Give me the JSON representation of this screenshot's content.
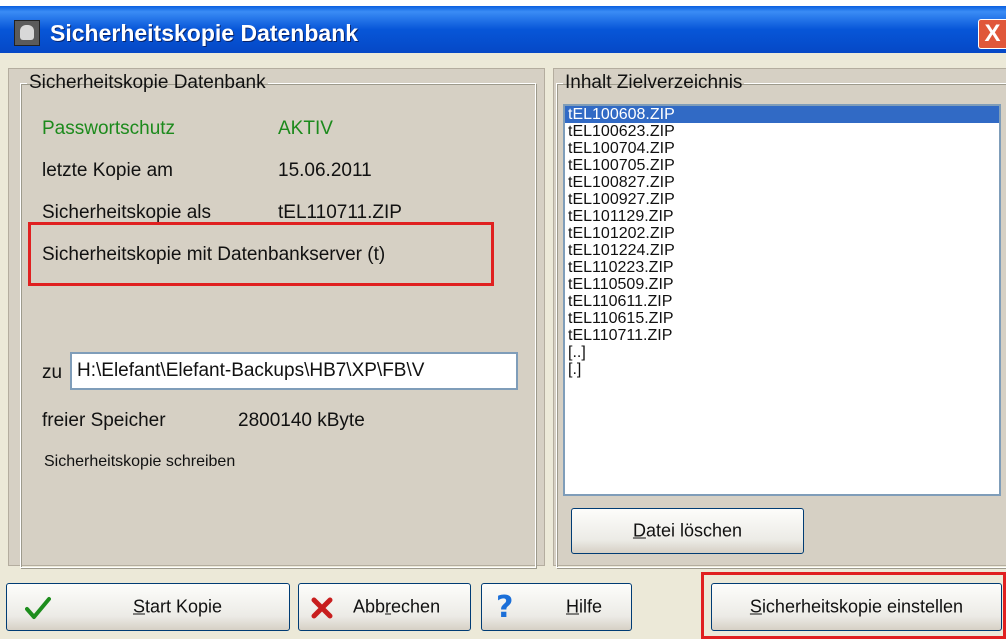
{
  "window": {
    "title": "Sicherheitskopie Datenbank",
    "close_glyph": "X"
  },
  "left_group": {
    "legend": "Sicherheitskopie Datenbank",
    "password_label": "Passwortschutz",
    "password_value": "AKTIV",
    "last_copy_label": "letzte Kopie am",
    "last_copy_value": "15.06.2011",
    "copy_as_label": "Sicherheitskopie als",
    "copy_as_value": "tEL110711.ZIP",
    "server_note": "Sicherheitskopie mit Datenbankserver (t)",
    "to_label": "zu",
    "path_value": "H:\\Elefant\\Elefant-Backups\\HB7\\XP\\FB\\V",
    "free_label": "freier Speicher",
    "free_value": "2800140 kByte",
    "status_text": "Sicherheitskopie schreiben"
  },
  "right_group": {
    "legend": "Inhalt Zielverzeichnis",
    "files": [
      "tEL100608.ZIP",
      "tEL100623.ZIP",
      "tEL100704.ZIP",
      "tEL100705.ZIP",
      "tEL100827.ZIP",
      "tEL100927.ZIP",
      "tEL101129.ZIP",
      "tEL101202.ZIP",
      "tEL101224.ZIP",
      "tEL110223.ZIP",
      "tEL110509.ZIP",
      "tEL110611.ZIP",
      "tEL110615.ZIP",
      "tEL110711.ZIP",
      "[..]",
      "[.]"
    ],
    "selected_index": 0,
    "delete_button": {
      "mnemonic": "D",
      "rest": "atei löschen"
    }
  },
  "buttons": {
    "start": {
      "pre": "",
      "mnemonic": "S",
      "rest": "tart Kopie",
      "icon": "checkmark-icon"
    },
    "cancel": {
      "pre": "Abb",
      "mnemonic": "r",
      "rest": "echen",
      "icon": "x-icon"
    },
    "help": {
      "pre": "",
      "mnemonic": "H",
      "rest": "ilfe",
      "icon": "question-mark-icon"
    },
    "settings": {
      "pre": "",
      "mnemonic": "S",
      "rest": "icherheitskopie einstellen"
    }
  },
  "colors": {
    "title_bar": "#0756d8",
    "selection": "#316ac5",
    "highlight_box": "#e02020",
    "status_green": "#1c8a1c"
  }
}
